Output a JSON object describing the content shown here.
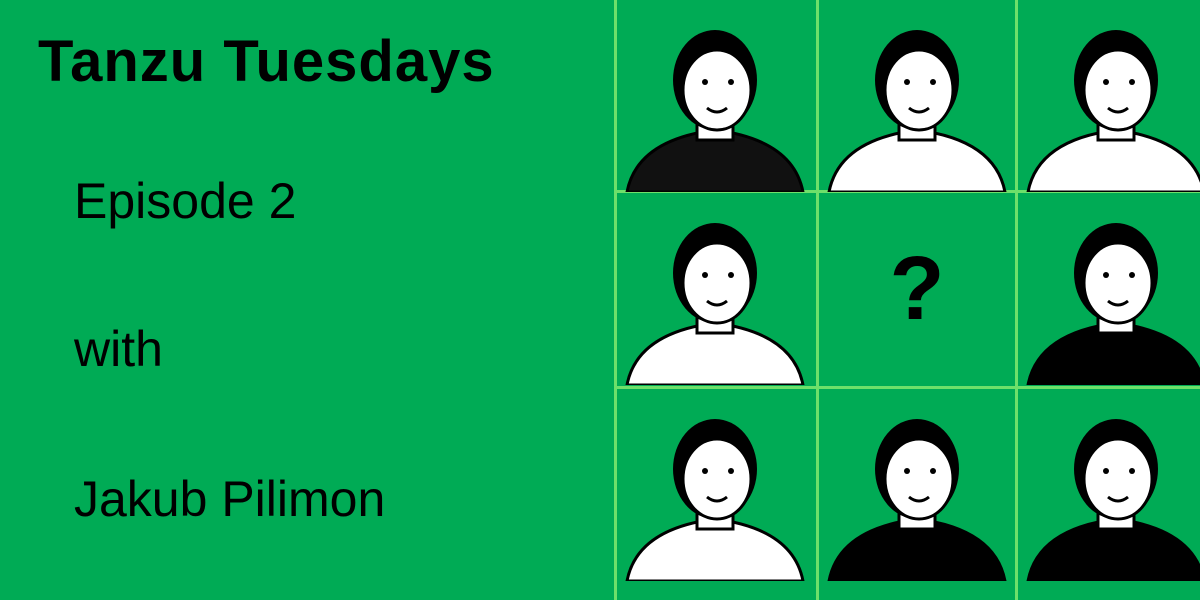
{
  "title": "Tanzu Tuesdays",
  "episode": "Episode 2",
  "with": "with",
  "guest": "Jakub Pilimon",
  "mystery_mark": "?",
  "colors": {
    "background": "#00ab55",
    "grid_lines": "#6ee06a",
    "ink": "#000000"
  }
}
